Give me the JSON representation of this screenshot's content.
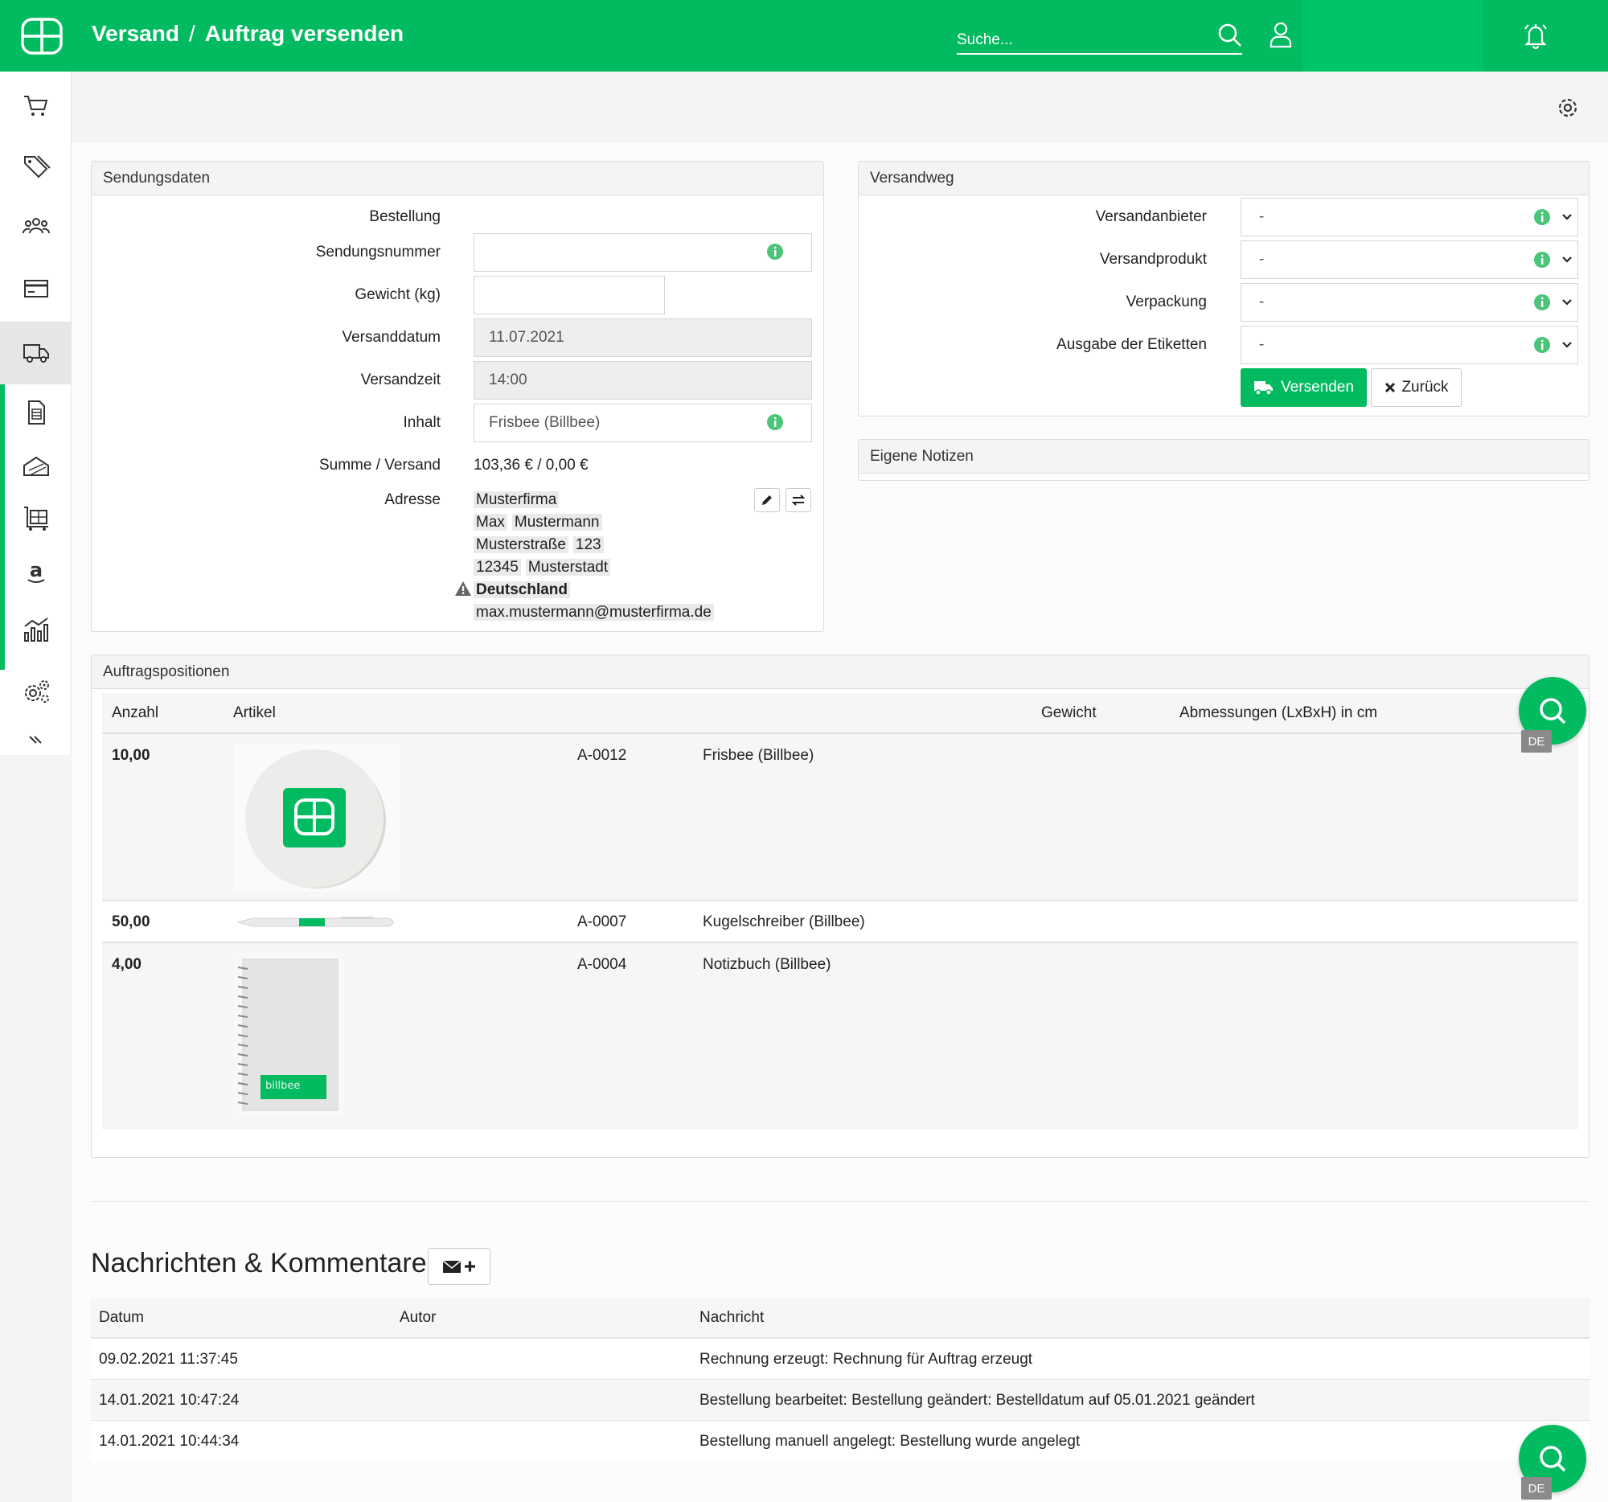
{
  "header": {
    "section": "Versand",
    "separator": "/",
    "page": "Auftrag versenden",
    "search_placeholder": "Suche..."
  },
  "sidebar": {
    "items": [
      {
        "icon": "cart-icon"
      },
      {
        "icon": "tags-icon"
      },
      {
        "icon": "users-icon"
      },
      {
        "icon": "payment-card-icon"
      },
      {
        "icon": "truck-icon",
        "active": true
      },
      {
        "icon": "invoice-icon"
      },
      {
        "icon": "returns-icon"
      },
      {
        "icon": "warehouse-cart-icon"
      },
      {
        "icon": "amazon-icon",
        "label": "a"
      },
      {
        "icon": "statistics-icon"
      },
      {
        "icon": "settings-icon"
      },
      {
        "icon": "collapse-icon"
      }
    ]
  },
  "sendungsdaten": {
    "title": "Sendungsdaten",
    "labels": {
      "bestellung": "Bestellung",
      "sendungsnummer": "Sendungsnummer",
      "gewicht": "Gewicht (kg)",
      "versanddatum": "Versanddatum",
      "versandzeit": "Versandzeit",
      "inhalt": "Inhalt",
      "summe": "Summe / Versand",
      "adresse": "Adresse"
    },
    "values": {
      "sendungsnummer": "",
      "gewicht": "",
      "versanddatum": "11.07.2021",
      "versandzeit": "14:00",
      "inhalt": "Frisbee (Billbee)",
      "summe": "103,36 € / 0,00 €"
    },
    "address": {
      "company": "Musterfirma",
      "first_name": "Max",
      "last_name": "Mustermann",
      "street": "Musterstraße",
      "house_no": "123",
      "zip": "12345",
      "city": "Musterstadt",
      "country": "Deutschland",
      "email": "max.mustermann@musterfirma.de"
    }
  },
  "versandweg": {
    "title": "Versandweg",
    "labels": {
      "anbieter": "Versandanbieter",
      "produkt": "Versandprodukt",
      "verpackung": "Verpackung",
      "etiketten": "Ausgabe der Etiketten"
    },
    "values": {
      "anbieter": "-",
      "produkt": "-",
      "verpackung": "-",
      "etiketten": "-"
    },
    "send_button": "Versenden",
    "back_button": "Zurück"
  },
  "notizen": {
    "title": "Eigene Notizen"
  },
  "positionen": {
    "title": "Auftragspositionen",
    "columns": {
      "anzahl": "Anzahl",
      "artikel": "Artikel",
      "gewicht": "Gewicht",
      "abmessungen": "Abmessungen (LxBxH) in cm"
    },
    "rows": [
      {
        "anzahl": "10,00",
        "sku": "A-0012",
        "name": "Frisbee (Billbee)"
      },
      {
        "anzahl": "50,00",
        "sku": "A-0007",
        "name": "Kugelschreiber (Billbee)"
      },
      {
        "anzahl": "4,00",
        "sku": "A-0004",
        "name": "Notizbuch (Billbee)"
      }
    ],
    "notebook_brand": "billbee"
  },
  "nachrichten": {
    "title": "Nachrichten & Kommentare",
    "columns": {
      "datum": "Datum",
      "autor": "Autor",
      "nachricht": "Nachricht"
    },
    "rows": [
      {
        "datum": "09.02.2021 11:37:45",
        "autor": "",
        "nachricht": "Rechnung erzeugt: Rechnung für Auftrag erzeugt"
      },
      {
        "datum": "14.01.2021 10:47:24",
        "autor": "",
        "nachricht": "Bestellung bearbeitet: Bestellung geändert: Bestelldatum auf 05.01.2021 geändert"
      },
      {
        "datum": "14.01.2021 10:44:34",
        "autor": "",
        "nachricht": "Bestellung manuell angelegt: Bestellung wurde angelegt"
      }
    ]
  },
  "fab": {
    "badge": "DE"
  },
  "colors": {
    "accent": "#02bb61",
    "info": "#4cc47a"
  }
}
